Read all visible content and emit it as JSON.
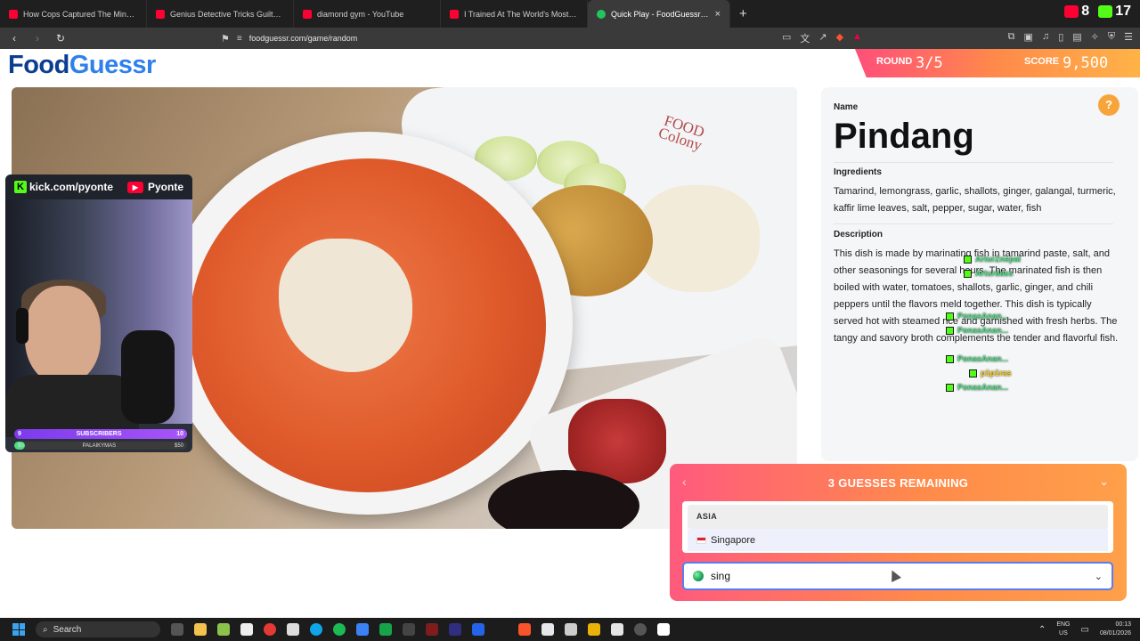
{
  "browser": {
    "tabs": [
      {
        "title": "How Cops Captured The Minnesota",
        "icon": "youtube-icon",
        "active": false
      },
      {
        "title": "Genius Detective Tricks Guilty Suspe",
        "icon": "youtube-icon",
        "active": false
      },
      {
        "title": "diamond gym - YouTube",
        "icon": "youtube-icon",
        "active": false
      },
      {
        "title": "I Trained At The World's Most Dange",
        "icon": "youtube-icon",
        "active": false
      },
      {
        "title": "Quick Play - FoodGuessr | FoodG",
        "icon": "foodguessr-icon",
        "active": true
      }
    ],
    "new_tab": "+",
    "close_tab": "×",
    "url": "foodguessr.com/game/random",
    "badges": {
      "youtube_count": "8",
      "kick_count": "17"
    }
  },
  "header": {
    "logo_part1": "Food",
    "logo_part2": "Guessr",
    "round_label": "ROUND",
    "round_value": "3/5",
    "score_label": "SCORE",
    "score_value": "9,500"
  },
  "webcam": {
    "kick_handle": "kick.com/pyonte",
    "youtube_handle": "Pyonte",
    "subscribers_label": "SUBSCRIBERS",
    "subscribers_current": "9",
    "subscribers_goal": "10",
    "goal_label": "PALAIKYMAS",
    "goal_current": "$0",
    "goal_target": "$50",
    "goal_fraction": 0.05
  },
  "photo": {
    "plate_brand_line1": "FOOD",
    "plate_brand_line2": "Colony"
  },
  "panel": {
    "help": "?",
    "name_label": "Name",
    "name": "Pindang",
    "ingredients_label": "Ingredients",
    "ingredients": "Tamarind, lemongrass, garlic, shallots, ginger, galangal, turmeric, kaffir lime leaves, salt, pepper, sugar, water, fish",
    "description_label": "Description",
    "description": "This dish is made by marinating fish in tamarind paste, salt, and other seasonings for several hours. The marinated fish is then boiled with water, tomatoes, shallots, garlic, ginger, and chili peppers until the flavors meld together. This dish is typically served hot with steamed rice and garnished with fresh herbs. The tangy and savory broth complements the tender and flavorful fish."
  },
  "chat": [
    {
      "name": "ArturZnepal",
      "color": "green"
    },
    {
      "name": "Arturdass",
      "color": "green"
    },
    {
      "name": "PonasAnan...",
      "color": "green"
    },
    {
      "name": "PonasAnan...",
      "color": "green"
    },
    {
      "name": "PonasAnan...",
      "color": "green"
    },
    {
      "name": "p1p1ras",
      "color": "yellow"
    },
    {
      "name": "PonasAnan...",
      "color": "green"
    }
  ],
  "guess": {
    "title": "3 GUESSES REMAINING",
    "region": "ASIA",
    "option": "Singapore",
    "input_value": "sing"
  },
  "taskbar": {
    "search_label": "Search",
    "lang_line1": "ENG",
    "lang_line2": "US",
    "time": "00:13",
    "date": "08/01/2026"
  }
}
